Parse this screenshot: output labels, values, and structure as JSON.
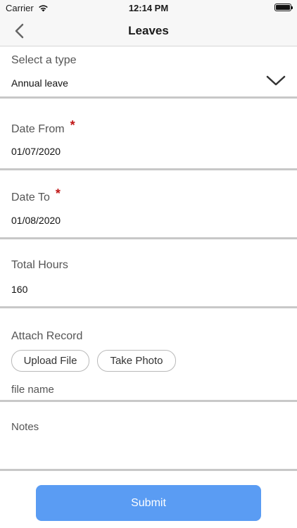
{
  "status_bar": {
    "carrier": "Carrier",
    "time": "12:14 PM",
    "battery_level": 1.0
  },
  "nav": {
    "title": "Leaves",
    "back_icon": "chevron-left-icon"
  },
  "type_section": {
    "label": "Select a type",
    "value": "Annual leave",
    "dropdown_icon": "chevron-down-icon"
  },
  "date_from": {
    "label": "Date From",
    "required_mark": "*",
    "value": "01/07/2020"
  },
  "date_to": {
    "label": "Date To",
    "required_mark": "*",
    "value": "01/08/2020"
  },
  "total_hours": {
    "label": "Total Hours",
    "value": "160"
  },
  "attach": {
    "label": "Attach Record",
    "upload_label": "Upload File",
    "photo_label": "Take Photo",
    "file_name": "file name"
  },
  "notes": {
    "label": "Notes",
    "value": ""
  },
  "submit_label": "Submit",
  "colors": {
    "accent": "#5a9cf3",
    "required": "#c01818",
    "divider": "#c8c8c8"
  }
}
